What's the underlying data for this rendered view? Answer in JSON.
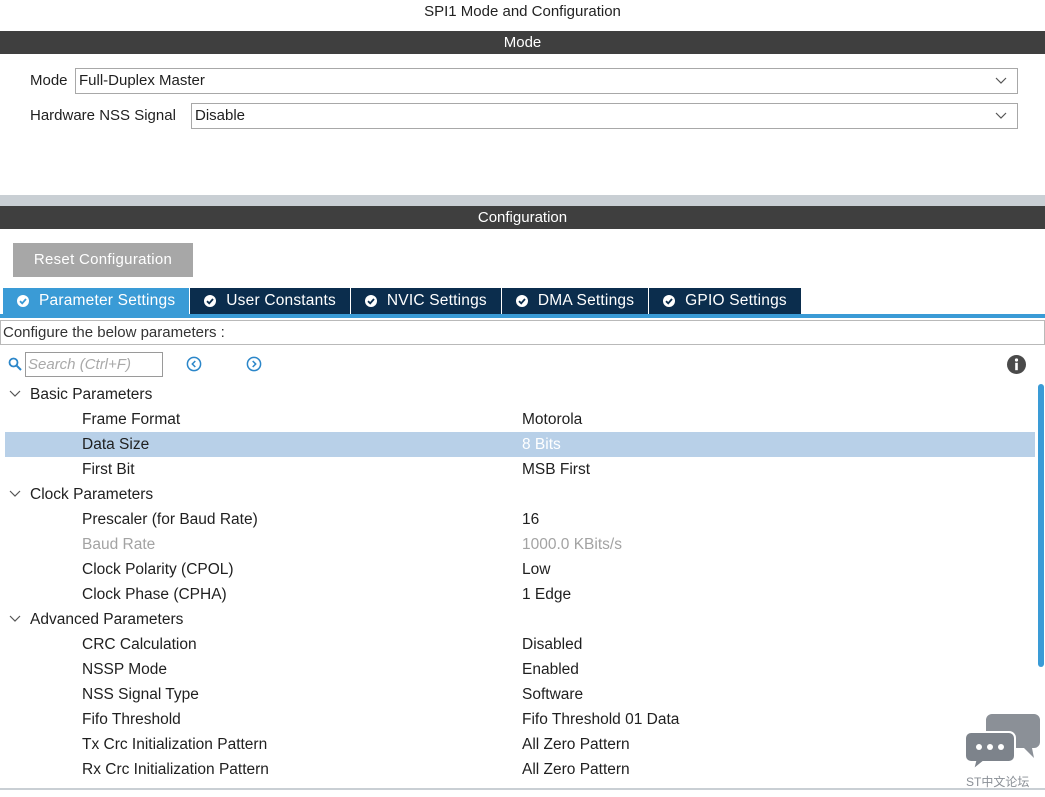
{
  "window_title": "SPI1 Mode and Configuration",
  "mode_section": {
    "header": "Mode",
    "fields": [
      {
        "label": "Mode",
        "value": "Full-Duplex Master"
      },
      {
        "label": "Hardware NSS Signal",
        "value": "Disable"
      }
    ]
  },
  "config_section": {
    "header": "Configuration",
    "reset_label": "Reset Configuration",
    "tabs": [
      {
        "label": "Parameter Settings",
        "active": true
      },
      {
        "label": "User Constants",
        "active": false
      },
      {
        "label": "NVIC Settings",
        "active": false
      },
      {
        "label": "DMA Settings",
        "active": false
      },
      {
        "label": "GPIO Settings",
        "active": false
      }
    ],
    "hint": "Configure the below parameters :",
    "search_placeholder": "Search (Ctrl+F)",
    "groups": [
      {
        "label": "Basic Parameters",
        "params": [
          {
            "name": "Frame Format",
            "value": "Motorola"
          },
          {
            "name": "Data Size",
            "value": "8 Bits"
          },
          {
            "name": "First Bit",
            "value": "MSB First"
          }
        ]
      },
      {
        "label": "Clock Parameters",
        "params": [
          {
            "name": "Prescaler (for Baud Rate)",
            "value": "16"
          },
          {
            "name": "Baud Rate",
            "value": "1000.0 KBits/s"
          },
          {
            "name": "Clock Polarity (CPOL)",
            "value": "Low"
          },
          {
            "name": "Clock Phase (CPHA)",
            "value": "1 Edge"
          }
        ]
      },
      {
        "label": "Advanced Parameters",
        "params": [
          {
            "name": "CRC Calculation",
            "value": "Disabled"
          },
          {
            "name": "NSSP Mode",
            "value": "Enabled"
          },
          {
            "name": "NSS Signal Type",
            "value": "Software"
          },
          {
            "name": "Fifo Threshold",
            "value": "Fifo Threshold 01 Data"
          },
          {
            "name": "Tx Crc Initialization Pattern",
            "value": "All Zero Pattern"
          },
          {
            "name": "Rx Crc Initialization Pattern",
            "value": "All Zero Pattern"
          }
        ]
      }
    ]
  },
  "watermark_text": "ST中文论坛",
  "colors": {
    "section_bar": "#3f3f3f",
    "tab_active": "#3a9bd6",
    "tab_inactive": "#0b2d4d",
    "row_selected": "#b8d0e8",
    "reset_button": "#a7a7a7",
    "icon_blue": "#2b86c9"
  },
  "icons": {
    "search": "search-icon",
    "prev": "circle-chevron-left-icon",
    "next": "circle-chevron-right-icon",
    "info": "info-icon",
    "tab_status": "check-circle-icon",
    "group_toggle": "chevron-down-icon",
    "watermark": "chat-bubbles-icon"
  }
}
